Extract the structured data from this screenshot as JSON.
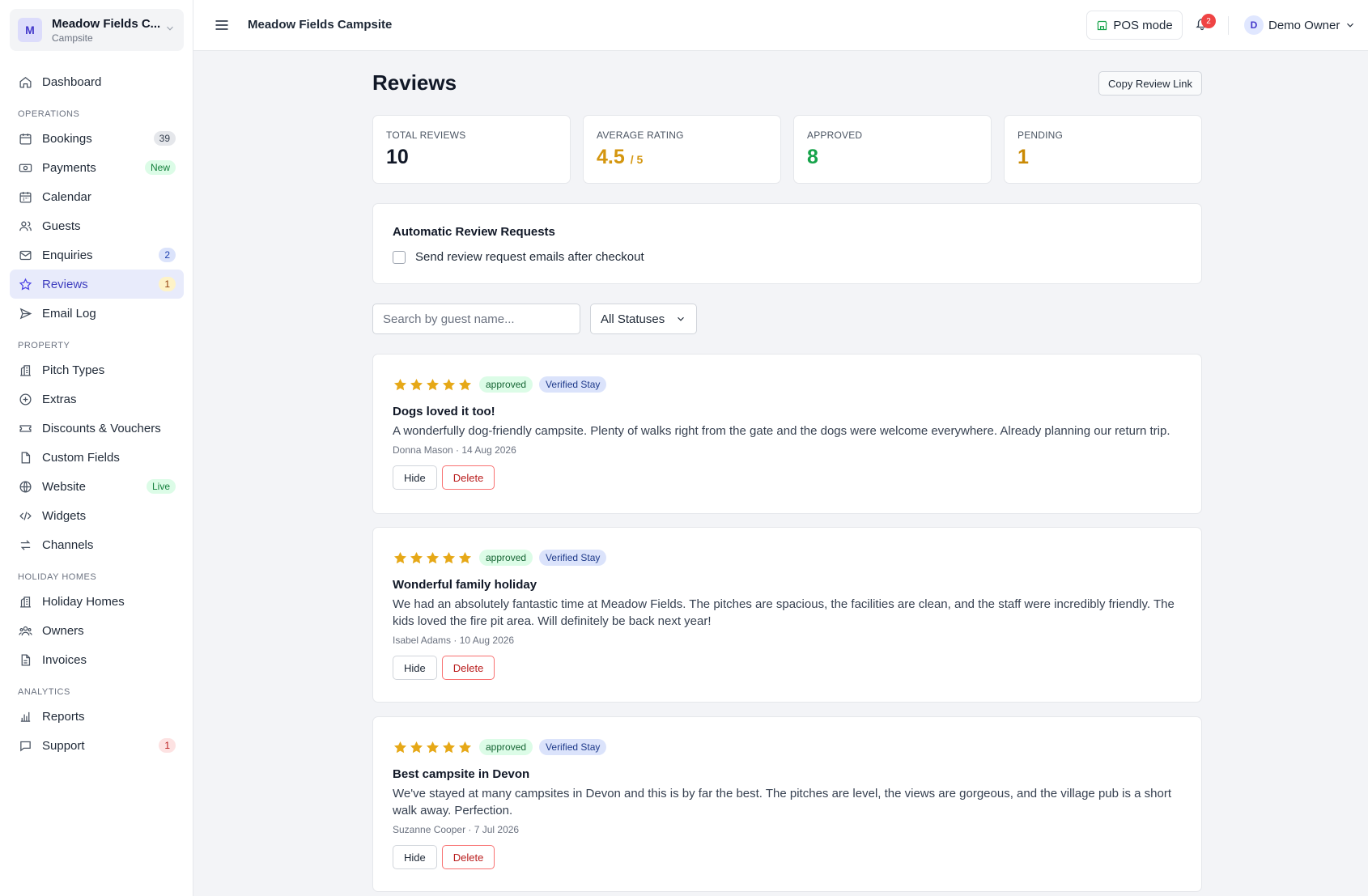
{
  "org": {
    "initial": "M",
    "name": "Meadow Fields C...",
    "type": "Campsite"
  },
  "nav": {
    "dashboard": "Dashboard",
    "sections": {
      "operations": "OPERATIONS",
      "property": "PROPERTY",
      "holiday_homes": "HOLIDAY HOMES",
      "analytics": "ANALYTICS"
    },
    "items": [
      {
        "label": "Bookings",
        "badge": "39"
      },
      {
        "label": "Payments",
        "badge": "New"
      },
      {
        "label": "Calendar"
      },
      {
        "label": "Guests"
      },
      {
        "label": "Enquiries",
        "badge": "2"
      },
      {
        "label": "Reviews",
        "badge": "1"
      },
      {
        "label": "Email Log"
      },
      {
        "label": "Pitch Types"
      },
      {
        "label": "Extras"
      },
      {
        "label": "Discounts & Vouchers"
      },
      {
        "label": "Custom Fields"
      },
      {
        "label": "Website",
        "badge": "Live"
      },
      {
        "label": "Widgets"
      },
      {
        "label": "Channels"
      },
      {
        "label": "Holiday Homes"
      },
      {
        "label": "Owners"
      },
      {
        "label": "Invoices"
      },
      {
        "label": "Reports"
      },
      {
        "label": "Support",
        "badge": "1"
      }
    ]
  },
  "header": {
    "title": "Meadow Fields Campsite",
    "pos_label": "POS mode",
    "notifications": "2",
    "user_initial": "D",
    "user_name": "Demo Owner"
  },
  "page": {
    "title": "Reviews",
    "copy_link": "Copy Review Link"
  },
  "stats": {
    "total": {
      "label": "TOTAL REVIEWS",
      "value": "10"
    },
    "average": {
      "label": "AVERAGE RATING",
      "value": "4.5",
      "suffix": "/ 5"
    },
    "approved": {
      "label": "APPROVED",
      "value": "8"
    },
    "pending": {
      "label": "PENDING",
      "value": "1"
    }
  },
  "auto_requests": {
    "title": "Automatic Review Requests",
    "checkbox_label": "Send review request emails after checkout",
    "checked": false
  },
  "filters": {
    "search_placeholder": "Search by guest name...",
    "status_selected": "All Statuses"
  },
  "reviews": [
    {
      "rating": 5,
      "status": "approved",
      "verified": "Verified Stay",
      "title": "Dogs loved it too!",
      "body": "A wonderfully dog-friendly campsite. Plenty of walks right from the gate and the dogs were welcome everywhere. Already planning our return trip.",
      "meta": "Donna Mason · 14 Aug 2026",
      "hide": "Hide",
      "delete": "Delete"
    },
    {
      "rating": 5,
      "status": "approved",
      "verified": "Verified Stay",
      "title": "Wonderful family holiday",
      "body": "We had an absolutely fantastic time at Meadow Fields. The pitches are spacious, the facilities are clean, and the staff were incredibly friendly. The kids loved the fire pit area. Will definitely be back next year!",
      "meta": "Isabel Adams · 10 Aug 2026",
      "hide": "Hide",
      "delete": "Delete"
    },
    {
      "rating": 5,
      "status": "approved",
      "verified": "Verified Stay",
      "title": "Best campsite in Devon",
      "body": "We've stayed at many campsites in Devon and this is by far the best. The pitches are level, the views are gorgeous, and the village pub is a short walk away. Perfection.",
      "meta": "Suzanne Cooper · 7 Jul 2026",
      "hide": "Hide",
      "delete": "Delete"
    }
  ],
  "colors": {
    "accent": "#4f46e5",
    "star": "#e6a817",
    "average": "#d4960f",
    "approved": "#16a34a",
    "pending": "#ca8a04"
  }
}
